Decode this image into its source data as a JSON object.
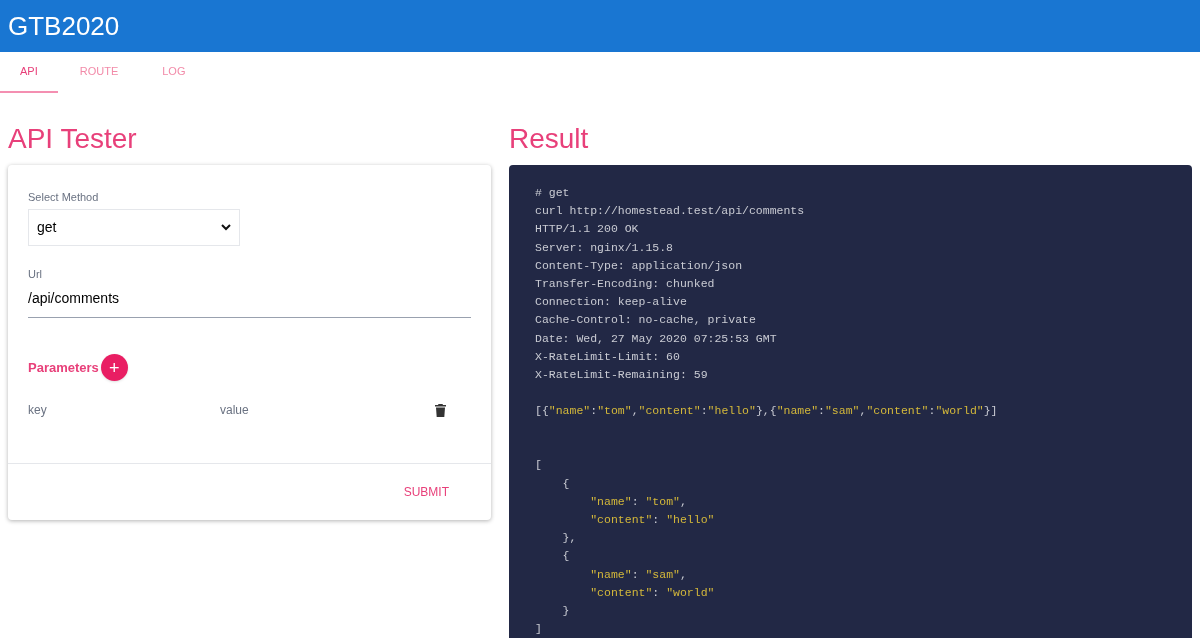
{
  "app_bar": {
    "title": "GTB2020"
  },
  "tabs": [
    {
      "label": "API",
      "selected": true
    },
    {
      "label": "ROUTE",
      "selected": false
    },
    {
      "label": "LOG",
      "selected": false
    }
  ],
  "tester": {
    "title": "API Tester",
    "method": {
      "label": "Select Method",
      "value": "get"
    },
    "url": {
      "label": "Url",
      "value": "/api/comments"
    },
    "parameters": {
      "title": "Parameters",
      "add_icon": "+",
      "rows": [
        {
          "key_placeholder": "key",
          "value_placeholder": "value"
        }
      ]
    },
    "submit": "SUBMIT"
  },
  "result": {
    "title": "Result",
    "blocks": [
      [
        "# get",
        "curl http://homestead.test/api/comments",
        "HTTP/1.1 200 OK",
        "Server: nginx/1.15.8",
        "Content-Type: application/json",
        "Transfer-Encoding: chunked",
        "Connection: keep-alive",
        "Cache-Control: no-cache, private",
        "Date: Wed, 27 May 2020 07:25:53 GMT",
        "X-RateLimit-Limit: 60",
        "X-RateLimit-Remaining: 59"
      ],
      [
        "[{\"name\":\"tom\",\"content\":\"hello\"},{\"name\":\"sam\",\"content\":\"world\"}]"
      ],
      [
        "[",
        "    {",
        "        \"name\": \"tom\",",
        "        \"content\": \"hello\"",
        "    },",
        "    {",
        "        \"name\": \"sam\",",
        "        \"content\": \"world\"",
        "    }",
        "]"
      ]
    ]
  }
}
